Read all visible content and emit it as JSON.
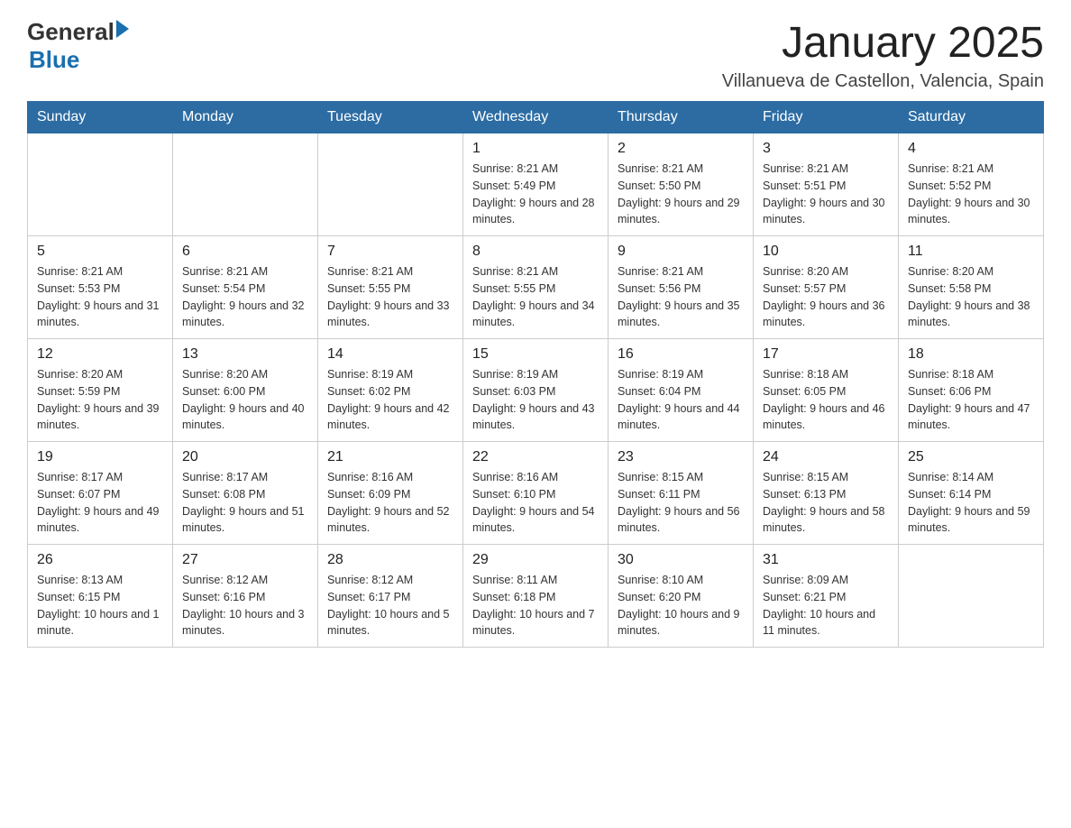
{
  "header": {
    "logo_general": "General",
    "logo_blue": "Blue",
    "title": "January 2025",
    "subtitle": "Villanueva de Castellon, Valencia, Spain"
  },
  "days_of_week": [
    "Sunday",
    "Monday",
    "Tuesday",
    "Wednesday",
    "Thursday",
    "Friday",
    "Saturday"
  ],
  "weeks": [
    [
      {
        "day": "",
        "info": ""
      },
      {
        "day": "",
        "info": ""
      },
      {
        "day": "",
        "info": ""
      },
      {
        "day": "1",
        "info": "Sunrise: 8:21 AM\nSunset: 5:49 PM\nDaylight: 9 hours and 28 minutes."
      },
      {
        "day": "2",
        "info": "Sunrise: 8:21 AM\nSunset: 5:50 PM\nDaylight: 9 hours and 29 minutes."
      },
      {
        "day": "3",
        "info": "Sunrise: 8:21 AM\nSunset: 5:51 PM\nDaylight: 9 hours and 30 minutes."
      },
      {
        "day": "4",
        "info": "Sunrise: 8:21 AM\nSunset: 5:52 PM\nDaylight: 9 hours and 30 minutes."
      }
    ],
    [
      {
        "day": "5",
        "info": "Sunrise: 8:21 AM\nSunset: 5:53 PM\nDaylight: 9 hours and 31 minutes."
      },
      {
        "day": "6",
        "info": "Sunrise: 8:21 AM\nSunset: 5:54 PM\nDaylight: 9 hours and 32 minutes."
      },
      {
        "day": "7",
        "info": "Sunrise: 8:21 AM\nSunset: 5:55 PM\nDaylight: 9 hours and 33 minutes."
      },
      {
        "day": "8",
        "info": "Sunrise: 8:21 AM\nSunset: 5:55 PM\nDaylight: 9 hours and 34 minutes."
      },
      {
        "day": "9",
        "info": "Sunrise: 8:21 AM\nSunset: 5:56 PM\nDaylight: 9 hours and 35 minutes."
      },
      {
        "day": "10",
        "info": "Sunrise: 8:20 AM\nSunset: 5:57 PM\nDaylight: 9 hours and 36 minutes."
      },
      {
        "day": "11",
        "info": "Sunrise: 8:20 AM\nSunset: 5:58 PM\nDaylight: 9 hours and 38 minutes."
      }
    ],
    [
      {
        "day": "12",
        "info": "Sunrise: 8:20 AM\nSunset: 5:59 PM\nDaylight: 9 hours and 39 minutes."
      },
      {
        "day": "13",
        "info": "Sunrise: 8:20 AM\nSunset: 6:00 PM\nDaylight: 9 hours and 40 minutes."
      },
      {
        "day": "14",
        "info": "Sunrise: 8:19 AM\nSunset: 6:02 PM\nDaylight: 9 hours and 42 minutes."
      },
      {
        "day": "15",
        "info": "Sunrise: 8:19 AM\nSunset: 6:03 PM\nDaylight: 9 hours and 43 minutes."
      },
      {
        "day": "16",
        "info": "Sunrise: 8:19 AM\nSunset: 6:04 PM\nDaylight: 9 hours and 44 minutes."
      },
      {
        "day": "17",
        "info": "Sunrise: 8:18 AM\nSunset: 6:05 PM\nDaylight: 9 hours and 46 minutes."
      },
      {
        "day": "18",
        "info": "Sunrise: 8:18 AM\nSunset: 6:06 PM\nDaylight: 9 hours and 47 minutes."
      }
    ],
    [
      {
        "day": "19",
        "info": "Sunrise: 8:17 AM\nSunset: 6:07 PM\nDaylight: 9 hours and 49 minutes."
      },
      {
        "day": "20",
        "info": "Sunrise: 8:17 AM\nSunset: 6:08 PM\nDaylight: 9 hours and 51 minutes."
      },
      {
        "day": "21",
        "info": "Sunrise: 8:16 AM\nSunset: 6:09 PM\nDaylight: 9 hours and 52 minutes."
      },
      {
        "day": "22",
        "info": "Sunrise: 8:16 AM\nSunset: 6:10 PM\nDaylight: 9 hours and 54 minutes."
      },
      {
        "day": "23",
        "info": "Sunrise: 8:15 AM\nSunset: 6:11 PM\nDaylight: 9 hours and 56 minutes."
      },
      {
        "day": "24",
        "info": "Sunrise: 8:15 AM\nSunset: 6:13 PM\nDaylight: 9 hours and 58 minutes."
      },
      {
        "day": "25",
        "info": "Sunrise: 8:14 AM\nSunset: 6:14 PM\nDaylight: 9 hours and 59 minutes."
      }
    ],
    [
      {
        "day": "26",
        "info": "Sunrise: 8:13 AM\nSunset: 6:15 PM\nDaylight: 10 hours and 1 minute."
      },
      {
        "day": "27",
        "info": "Sunrise: 8:12 AM\nSunset: 6:16 PM\nDaylight: 10 hours and 3 minutes."
      },
      {
        "day": "28",
        "info": "Sunrise: 8:12 AM\nSunset: 6:17 PM\nDaylight: 10 hours and 5 minutes."
      },
      {
        "day": "29",
        "info": "Sunrise: 8:11 AM\nSunset: 6:18 PM\nDaylight: 10 hours and 7 minutes."
      },
      {
        "day": "30",
        "info": "Sunrise: 8:10 AM\nSunset: 6:20 PM\nDaylight: 10 hours and 9 minutes."
      },
      {
        "day": "31",
        "info": "Sunrise: 8:09 AM\nSunset: 6:21 PM\nDaylight: 10 hours and 11 minutes."
      },
      {
        "day": "",
        "info": ""
      }
    ]
  ]
}
